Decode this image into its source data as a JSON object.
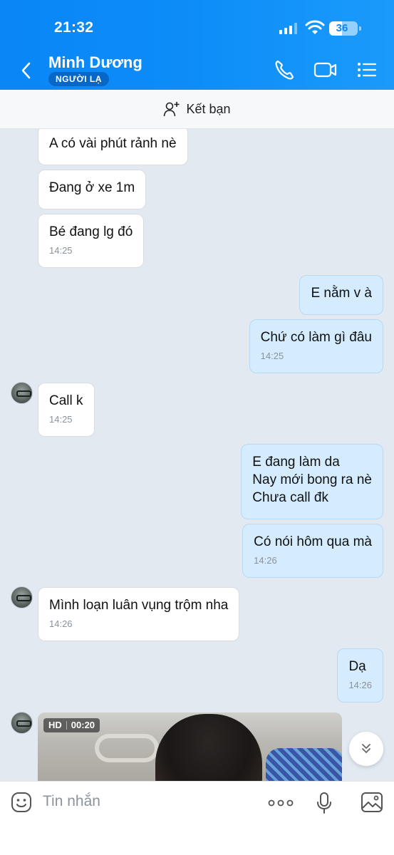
{
  "status_bar": {
    "time": "21:32",
    "battery": "36"
  },
  "header": {
    "contact_name": "Minh Dương",
    "badge": "NGƯỜI LẠ",
    "accent": "#0a86f7"
  },
  "friend_bar": {
    "label": "Kết bạn"
  },
  "messages": [
    {
      "side": "in",
      "text": "A có vài phút rảnh nè"
    },
    {
      "side": "in",
      "text": "Đang ở xe 1m"
    },
    {
      "side": "in",
      "text": "Bé đang lg đó",
      "time": "14:25"
    },
    {
      "side": "out",
      "text": "E nằm v à"
    },
    {
      "side": "out",
      "text": "Chứ có làm gì đâu",
      "time": "14:25"
    },
    {
      "side": "in",
      "text": "Call k",
      "time": "14:25"
    },
    {
      "side": "out",
      "lines": [
        "E đang làm da",
        "Nay mới bong ra nè",
        "Chưa call đk"
      ]
    },
    {
      "side": "out",
      "text": "Có nói hôm qua mà",
      "time": "14:26"
    },
    {
      "side": "in",
      "text": "Mình loạn luân vụng trộm nha",
      "time": "14:26"
    },
    {
      "side": "out",
      "text": "Dạ",
      "time": "14:26"
    }
  ],
  "video": {
    "quality": "HD",
    "duration": "00:20"
  },
  "input": {
    "placeholder": "Tin nhắn"
  },
  "icons": [
    "back-icon",
    "phone-icon",
    "video-call-icon",
    "menu-list-icon",
    "add-friend-icon",
    "emoji-icon",
    "more-icon",
    "microphone-icon",
    "image-icon",
    "chevron-double-down-icon"
  ]
}
